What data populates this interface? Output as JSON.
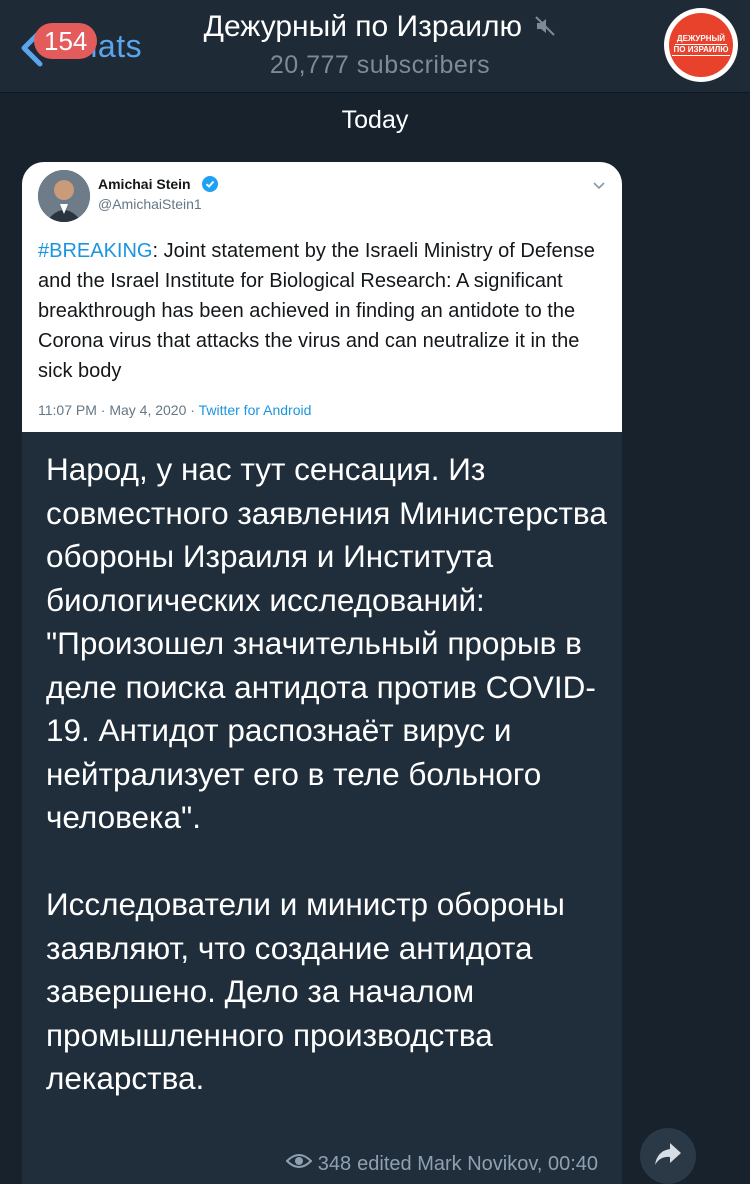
{
  "header": {
    "back_label": "Chats",
    "unread_badge": "154",
    "title": "Дежурный по Израилю",
    "subscribers": "20,777 subscribers",
    "avatar_text_line1": "ДЕЖУРНЫЙ",
    "avatar_text_line2": "ПО ИЗРАИЛЮ"
  },
  "date_separator": "Today",
  "tweet": {
    "author_name": "Amichai Stein",
    "author_handle": "@AmichaiStein1",
    "hashtag": "#BREAKING",
    "body": ": Joint statement by the Israeli Ministry of Defense and the Israel Institute for Biological Research: A significant breakthrough has been achieved in finding an antidote to the Corona virus that attacks the virus and can neutralize it in the sick body",
    "meta_time": "11:07 PM · May 4, 2020 · ",
    "meta_source": "Twitter for Android"
  },
  "message": {
    "text": "Народ, у нас тут сенсация. Из совместного заявления Министерства обороны Израиля и Института  биологических исследований: \"Произошел значительный прорыв в деле поиска антидота против COVID-19. Антидот распознаёт вирус и нейтрализует его в теле больного человека\".\n\nИсследователи и министр обороны заявляют, что создание антидота завершено. Дело за началом промышленного производства лекарства.",
    "views": "348",
    "edited_by": "edited Mark Novikov, 00:40"
  },
  "colors": {
    "background": "#18222d",
    "header": "#1e2a36",
    "bubble": "#202e3c",
    "accent": "#5aa5ec",
    "badge": "#e45b5b",
    "twitter_blue": "#1b95e0"
  }
}
